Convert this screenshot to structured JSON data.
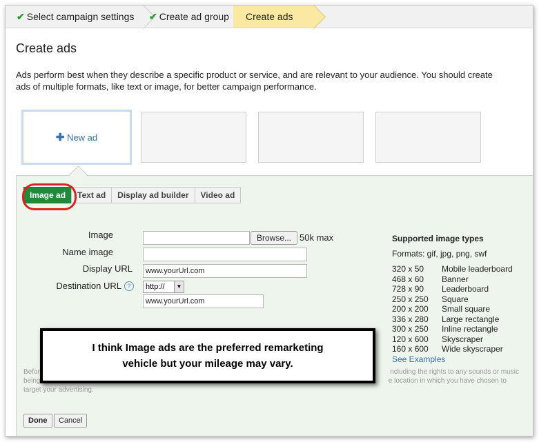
{
  "breadcrumb": {
    "step1": "Select campaign settings",
    "step2": "Create ad group",
    "step3": "Create ads"
  },
  "page_title": "Create ads",
  "intro": "Ads perform best when they describe a specific product or service, and are relevant to your audience. You should create ads of multiple formats, like text or image, for better campaign performance.",
  "new_ad_label": "New ad",
  "tabs": [
    {
      "label": "Image ad",
      "selected": true
    },
    {
      "label": "Text ad",
      "selected": false
    },
    {
      "label": "Display ad builder",
      "selected": false
    },
    {
      "label": "Video ad",
      "selected": false
    }
  ],
  "form": {
    "image_label": "Image",
    "browse_label": "Browse...",
    "max_size": "50k max",
    "name_label": "Name image",
    "display_url_label": "Display URL",
    "display_url_value": "www.yourUrl.com",
    "dest_url_label": "Destination URL",
    "protocol_value": "http://",
    "dest_url_value": "www.yourUrl.com",
    "help_glyph": "?"
  },
  "supported": {
    "heading": "Supported image types",
    "formats": "Formats: gif, jpg, png, swf",
    "sizes": [
      {
        "size": "320 x 50",
        "name": "Mobile leaderboard"
      },
      {
        "size": "468 x 60",
        "name": "Banner"
      },
      {
        "size": "728 x 90",
        "name": "Leaderboard"
      },
      {
        "size": "250 x 250",
        "name": "Square"
      },
      {
        "size": "200 x 200",
        "name": "Small square"
      },
      {
        "size": "336 x 280",
        "name": "Large rectangle"
      },
      {
        "size": "300 x 250",
        "name": "Inline rectangle"
      },
      {
        "size": "120 x 600",
        "name": "Skyscraper"
      },
      {
        "size": "160 x 600",
        "name": "Wide skyscraper"
      }
    ],
    "see_examples": "See Examples"
  },
  "legal": {
    "line1_start": "Before",
    "line1_end": "ncluding the rights to any sounds or music",
    "line2_start": "being",
    "line2_end": "e location in which you have chosen to",
    "line3": "target your advertising."
  },
  "done_label": "Done",
  "cancel_label": "Cancel",
  "callout": {
    "line1": "I think Image ads are the preferred remarketing",
    "line2": "vehicle but your mileage may vary."
  },
  "colors": {
    "selected_tab": "#1f8a3a",
    "annotation": "#e02020",
    "link": "#3a6fb0"
  }
}
